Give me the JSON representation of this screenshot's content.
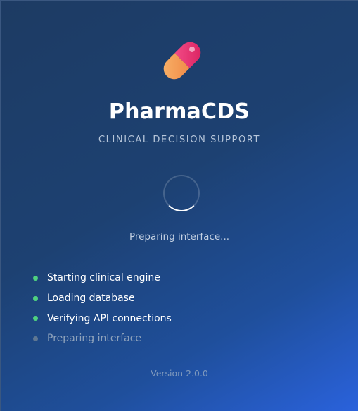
{
  "app": {
    "title": "PharmaCDS",
    "subtitle": "CLINICAL DECISION SUPPORT",
    "logo_icon": "pill-capsule-icon"
  },
  "loader": {
    "status": "Preparing interface..."
  },
  "steps": [
    {
      "label": "Starting clinical engine",
      "state": "done"
    },
    {
      "label": "Loading database",
      "state": "done"
    },
    {
      "label": "Verifying API connections",
      "state": "done"
    },
    {
      "label": "Preparing interface",
      "state": "pending"
    }
  ],
  "footer": {
    "version": "Version 2.0.0"
  },
  "colors": {
    "done": "#4fd07f",
    "pending": "#5f7792",
    "capsule_top": "#e8336e",
    "capsule_bottom": "#f5a25b"
  }
}
